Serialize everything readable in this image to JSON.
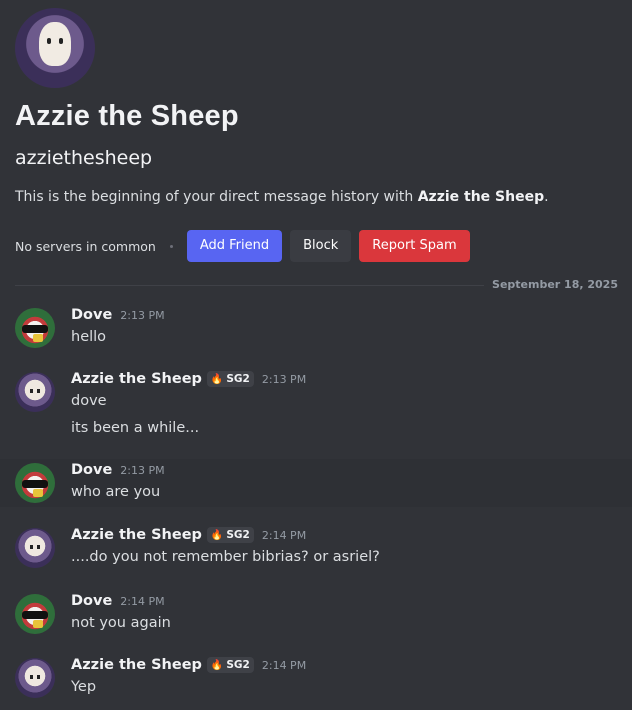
{
  "profile": {
    "display_name": "Azzie the Sheep",
    "username": "azziethesheep",
    "intro_prefix": "This is the beginning of your direct message history with ",
    "intro_name": "Azzie the Sheep",
    "intro_suffix": ".",
    "no_servers": "No servers in common",
    "buttons": {
      "add_friend": "Add Friend",
      "block": "Block",
      "report_spam": "Report Spam"
    }
  },
  "date_divider": "September 18, 2025",
  "messages": [
    {
      "author": "Dove",
      "time": "2:13 PM",
      "tag": null,
      "lines": [
        "hello"
      ]
    },
    {
      "author": "Azzie the Sheep",
      "time": "2:13 PM",
      "tag": "SG2",
      "lines": [
        "dove",
        "its been a while..."
      ]
    },
    {
      "author": "Dove",
      "time": "2:13 PM",
      "tag": null,
      "lines": [
        "who are you"
      ]
    },
    {
      "author": "Azzie the Sheep",
      "time": "2:14 PM",
      "tag": "SG2",
      "lines": [
        "....do you not remember bibrias? or asriel?"
      ]
    },
    {
      "author": "Dove",
      "time": "2:14 PM",
      "tag": null,
      "lines": [
        "not you again"
      ]
    },
    {
      "author": "Azzie the Sheep",
      "time": "2:14 PM",
      "tag": "SG2",
      "lines": [
        "Yep"
      ]
    }
  ],
  "colors": {
    "background": "#313338",
    "blurple": "#5865f2",
    "danger": "#da373c",
    "muted": "#949ba4"
  }
}
